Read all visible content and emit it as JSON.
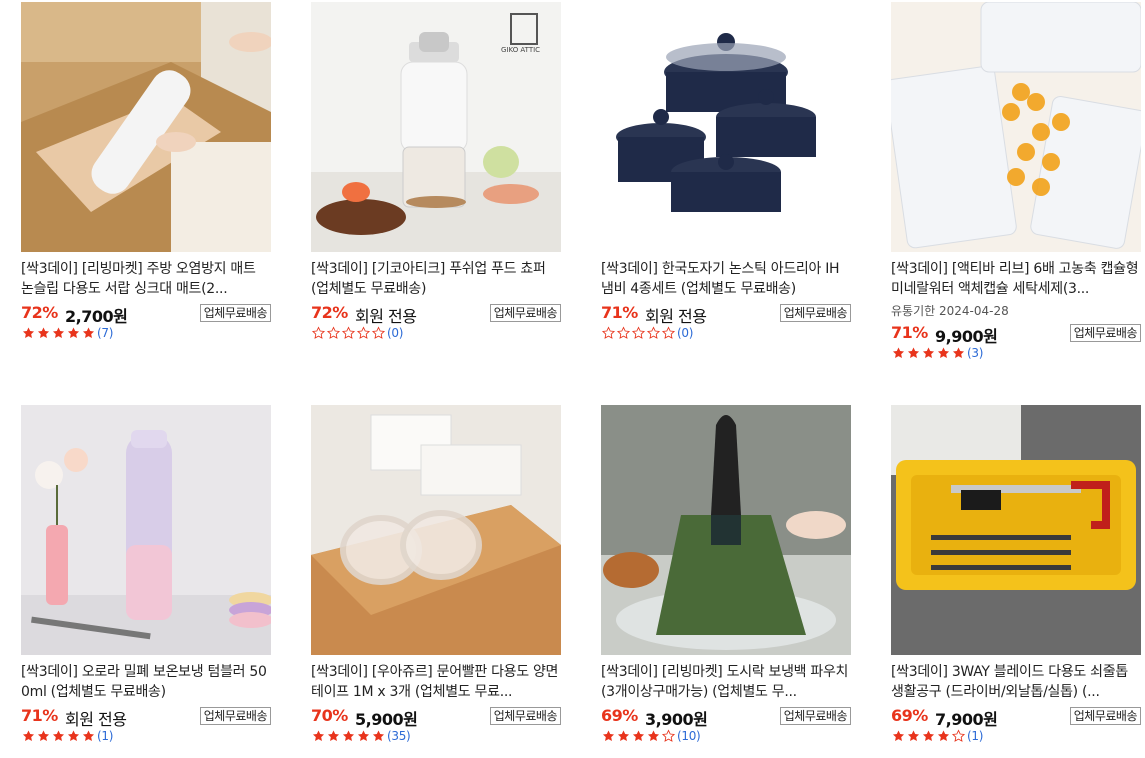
{
  "products": [
    {
      "title": "[싹3데이] [리빙마켓] 주방 오염방지 매트 논슬립 다용도 서랍 싱크대 매트(2...",
      "discount": "72%",
      "price": "2,700원",
      "badge": "업체무료배송",
      "rating": 5,
      "review_count": "(7)",
      "image": "drawer-mat-photo"
    },
    {
      "title": "[싹3데이] [기코아티크] 푸쉬업 푸드 쵸퍼 (업체별도 무료배송)",
      "discount": "72%",
      "price": "회원 전용",
      "badge": "업체무료배송",
      "rating": 0,
      "review_count": "(0)",
      "image": "food-chopper-photo",
      "brand_logo": "GIKO ATTIC"
    },
    {
      "title": "[싹3데이] 한국도자기 논스틱 아드리아 IH 냄비 4종세트 (업체별도 무료배송)",
      "discount": "71%",
      "price": "회원 전용",
      "badge": "업체무료배송",
      "rating": 0,
      "review_count": "(0)",
      "image": "pot-set-photo"
    },
    {
      "title": "[싹3데이] [액티바 리브] 6배 고농축 캡슐형 미네랄워터 액체캡슐 세탁세제(3...",
      "expiry": "유통기한 2024-04-28",
      "discount": "71%",
      "price": "9,900원",
      "badge": "업체무료배송",
      "rating": 5,
      "review_count": "(3)",
      "image": "laundry-capsule-photo"
    },
    {
      "title": "[싹3데이] 오로라 밀폐 보온보냉 텀블러 500ml (업체별도 무료배송)",
      "discount": "71%",
      "price": "회원 전용",
      "badge": "업체무료배송",
      "rating": 5,
      "review_count": "(1)",
      "image": "tumbler-photo"
    },
    {
      "title": "[싹3데이] [우아쥬르] 문어빨판 다용도 양면테이프 1M x 3개 (업체별도 무료...",
      "discount": "70%",
      "price": "5,900원",
      "badge": "업체무료배송",
      "rating": 5,
      "review_count": "(35)",
      "image": "tape-photo"
    },
    {
      "title": "[싹3데이] [리빙마켓] 도시락 보냉백 파우치(3개이상구매가능) (업체별도 무...",
      "discount": "69%",
      "price": "3,900원",
      "badge": "업체무료배송",
      "rating": 4,
      "review_count": "(10)",
      "image": "lunch-bag-photo"
    },
    {
      "title": "[싹3데이] 3WAY 블레이드 다용도 쇠줄톱 생활공구 (드라이버/외날톱/실톱) (...",
      "discount": "69%",
      "price": "7,900원",
      "badge": "업체무료배송",
      "rating": 4,
      "review_count": "(1)",
      "image": "saw-tool-photo"
    }
  ],
  "colors": {
    "discount": "#e8341c",
    "star_filled": "#e8341c",
    "star_empty": "#e8341c",
    "review_count": "#2d6bd6"
  }
}
